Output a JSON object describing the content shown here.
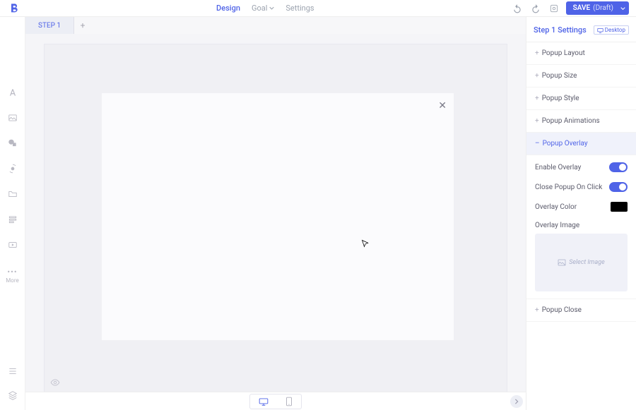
{
  "header": {
    "tabs": {
      "design": "Design",
      "goal": "Goal",
      "settings": "Settings"
    },
    "save": {
      "main": "SAVE",
      "draft": "(Draft)"
    }
  },
  "canvas": {
    "tab_label": "STEP 1"
  },
  "right_panel": {
    "title": "Step 1 Settings",
    "device_badge": "Desktop",
    "sections": {
      "layout": "Popup Layout",
      "size": "Popup Size",
      "style": "Popup Style",
      "animations": "Popup Animations",
      "overlay": "Popup Overlay",
      "close": "Popup Close"
    },
    "overlay": {
      "enable_label": "Enable Overlay",
      "close_click_label": "Close Popup On Click",
      "color_label": "Overlay Color",
      "color_value": "#000000",
      "image_label": "Overlay Image",
      "select_image": "Select Image"
    }
  },
  "left_toolbar": {
    "more": "More"
  }
}
